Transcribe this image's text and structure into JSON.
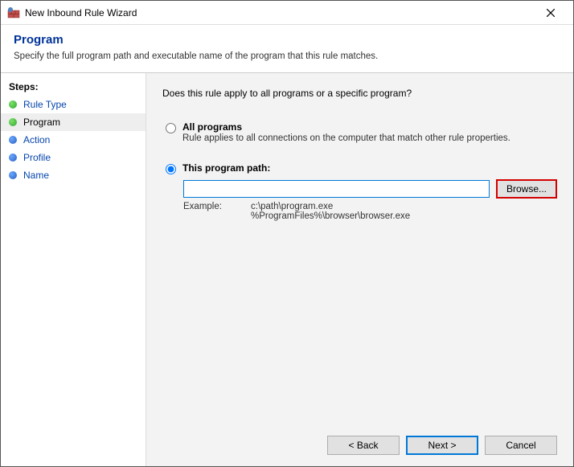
{
  "window": {
    "title": "New Inbound Rule Wizard"
  },
  "header": {
    "title": "Program",
    "description": "Specify the full program path and executable name of the program that this rule matches."
  },
  "sidebar": {
    "label": "Steps:",
    "items": [
      {
        "label": "Rule Type"
      },
      {
        "label": "Program"
      },
      {
        "label": "Action"
      },
      {
        "label": "Profile"
      },
      {
        "label": "Name"
      }
    ]
  },
  "main": {
    "question": "Does this rule apply to all programs or a specific program?",
    "option_all": {
      "title": "All programs",
      "desc": "Rule applies to all connections on the computer that match other rule properties."
    },
    "option_path": {
      "title": "This program path:",
      "value": "",
      "browse_label": "Browse...",
      "example_label": "Example:",
      "example_lines": "c:\\path\\program.exe\n%ProgramFiles%\\browser\\browser.exe"
    },
    "selected": "path"
  },
  "footer": {
    "back": "< Back",
    "next": "Next >",
    "cancel": "Cancel"
  }
}
